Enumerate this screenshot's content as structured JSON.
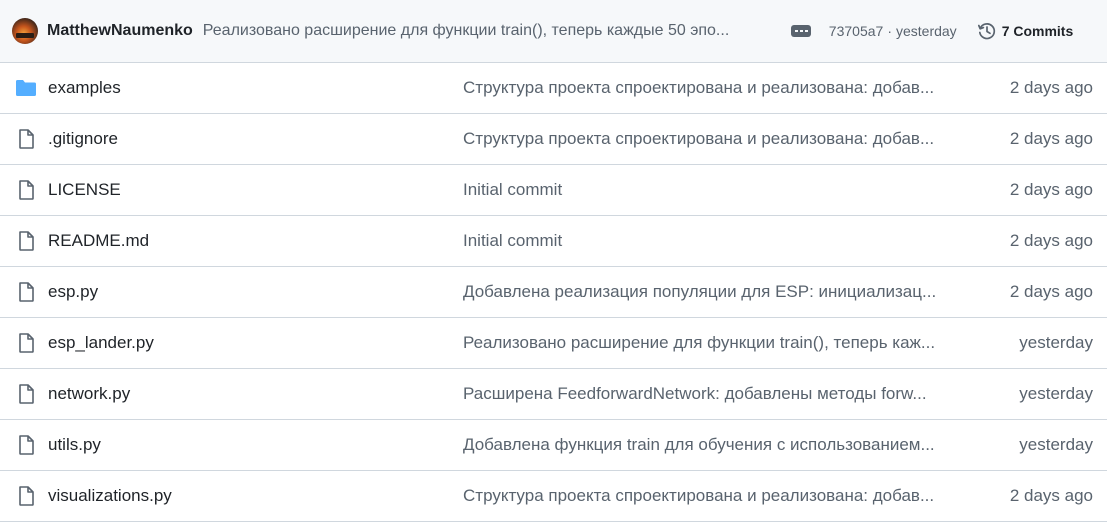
{
  "latest_commit": {
    "author": "MatthewNaumenko",
    "message": "Реализовано расширение для функции train(), теперь каждые 50 эпо...",
    "sha": "73705a7",
    "separator": "·",
    "when": "yesterday",
    "commits_label": "7 Commits"
  },
  "files": [
    {
      "name": "examples",
      "type": "folder",
      "message": "Структура проекта спроектирована и реализована: добав...",
      "age": "2 days ago"
    },
    {
      "name": ".gitignore",
      "type": "file",
      "message": "Структура проекта спроектирована и реализована: добав...",
      "age": "2 days ago"
    },
    {
      "name": "LICENSE",
      "type": "file",
      "message": "Initial commit",
      "age": "2 days ago"
    },
    {
      "name": "README.md",
      "type": "file",
      "message": "Initial commit",
      "age": "2 days ago"
    },
    {
      "name": "esp.py",
      "type": "file",
      "message": "Добавлена реализация популяции для ESP: инициализац...",
      "age": "2 days ago"
    },
    {
      "name": "esp_lander.py",
      "type": "file",
      "message": "Реализовано расширение для функции train(), теперь каж...",
      "age": "yesterday"
    },
    {
      "name": "network.py",
      "type": "file",
      "message": "Расширена FeedforwardNetwork: добавлены методы forw...",
      "age": "yesterday"
    },
    {
      "name": "utils.py",
      "type": "file",
      "message": "Добавлена функция train для обучения с использованием...",
      "age": "yesterday"
    },
    {
      "name": "visualizations.py",
      "type": "file",
      "message": "Структура проекта спроектирована и реализована: добав...",
      "age": "2 days ago"
    }
  ],
  "colors": {
    "folder_icon": "#54aeff",
    "file_icon": "#59636e",
    "muted_text": "#59636e",
    "border": "#d0d7de",
    "header_bg": "#f6f8fa"
  }
}
